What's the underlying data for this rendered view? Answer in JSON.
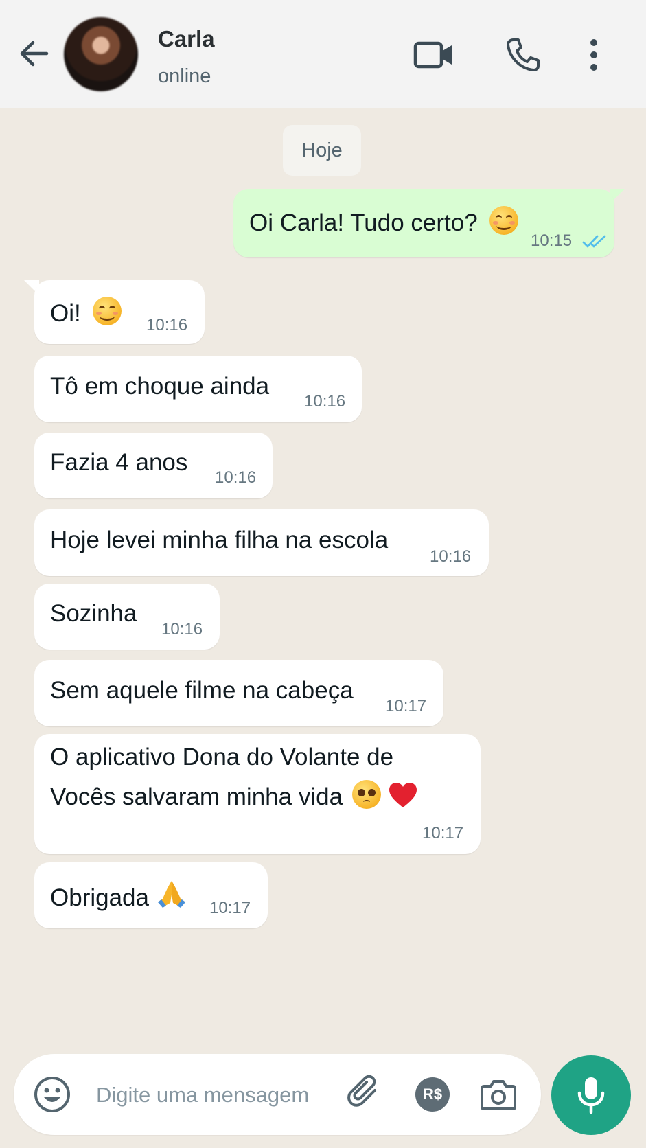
{
  "header": {
    "contact_name": "Carla",
    "status": "online",
    "icons": [
      "back-arrow-icon",
      "video-call-icon",
      "phone-icon",
      "more-vertical-icon"
    ]
  },
  "chat": {
    "date_label": "Hoje",
    "messages": [
      {
        "direction": "out",
        "text": "Oi Carla! Tudo certo?",
        "emoji": "😊",
        "time": "10:15",
        "status": "read"
      },
      {
        "direction": "in",
        "text": "Oi!",
        "emoji": "😊",
        "time": "10:16"
      },
      {
        "direction": "in",
        "text": "Tô em choque ainda",
        "time": "10:16"
      },
      {
        "direction": "in",
        "text": "Fazia 4 anos",
        "time": "10:16"
      },
      {
        "direction": "in",
        "text": "Hoje levei minha filha na escola",
        "time": "10:16"
      },
      {
        "direction": "in",
        "text": "Sozinha",
        "time": "10:16"
      },
      {
        "direction": "in",
        "text": "Sem aquele filme na cabeça",
        "time": "10:17"
      },
      {
        "direction": "in",
        "line1": "O aplicativo Dona do Volante de",
        "line2": "Vocês salvaram minha vida",
        "emoji": "🥺❤️",
        "time": "10:17"
      },
      {
        "direction": "in",
        "text": "Obrigada",
        "emoji": "🙏",
        "time": "10:17"
      }
    ]
  },
  "composer": {
    "placeholder": "Digite uma mensagem",
    "value": "",
    "payment_label": "R$",
    "icons": [
      "emoji-icon",
      "attach-icon",
      "payment-icon",
      "camera-icon",
      "mic-icon"
    ]
  },
  "colors": {
    "background": "#efeae2",
    "header": "#f3f3f3",
    "outgoing_bubble": "#d9fdd3",
    "incoming_bubble": "#ffffff",
    "accent": "#1fa385",
    "read_ticks": "#53bdeb"
  }
}
